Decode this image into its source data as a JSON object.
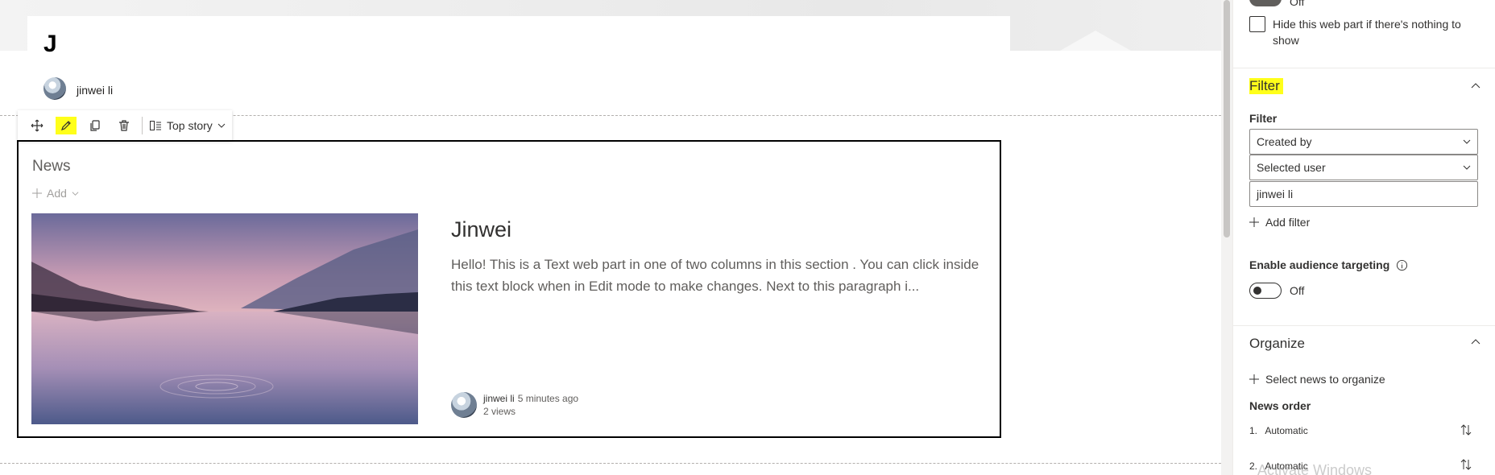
{
  "page": {
    "title": "J",
    "author": "jinwei li"
  },
  "toolbar": {
    "move_icon": "move-icon",
    "edit_icon": "pencil-icon",
    "duplicate_icon": "duplicate-icon",
    "delete_icon": "trash-icon",
    "layout_label": "Top story"
  },
  "news": {
    "title": "News",
    "add_label": "Add",
    "story": {
      "title": "Jinwei",
      "description": "Hello! This is a Text web part in one of two columns in this section . You can click inside this text block when in Edit mode to make changes. Next to this paragraph i...",
      "author": "jinwei li",
      "time": "5 minutes ago",
      "views": "2 views"
    }
  },
  "pane": {
    "top_toggle_label": "Off",
    "hide_checkbox_label": "Hide this web part if there's nothing to show",
    "filter_section": {
      "heading": "Filter",
      "field_label": "Filter",
      "filter_by": "Created by",
      "user_option": "Selected user",
      "user_value": "jinwei li",
      "add_filter_label": "Add filter"
    },
    "audience": {
      "label": "Enable audience targeting",
      "toggle_label": "Off"
    },
    "organize": {
      "heading": "Organize",
      "select_label": "Select news to organize",
      "order_label": "News order",
      "orders": [
        {
          "num": "1.",
          "value": "Automatic"
        },
        {
          "num": "2.",
          "value": "Automatic"
        }
      ]
    },
    "watermark": "Activate Windows"
  },
  "colors": {
    "highlight": "#ffff1a",
    "border": "#000000",
    "text": "#323130"
  }
}
